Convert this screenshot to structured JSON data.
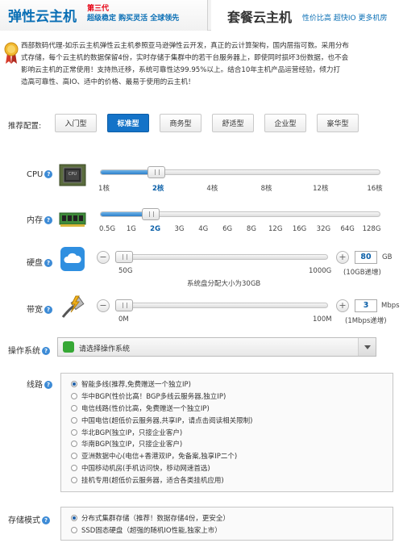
{
  "tabs": {
    "active": {
      "title": "弹性云主机",
      "badge": "第三代",
      "subtitle": "超级稳定 购买灵活 全球领先"
    },
    "inactive": {
      "title": "套餐云主机",
      "subtitle": "性价比高 超快IO 更多机房"
    }
  },
  "intro": {
    "lines": [
      "西部数码代理-如乐云主机弹性云主机参照亚马逊弹性云开发，真正的云计算架构，国内层指可数。采用分布",
      "式存储，每个云主机的数据保留4份，实时存储于集群中的若干台服务器上，即使同时损坏3份数据，也不会",
      "影响云主机的正常使用！支持热迁移，系统可靠性达99.95%以上。结合10年主机产品运营经验，倾力打",
      "造高可靠性、高IO、适中的价格、最易于使用的云主机！"
    ]
  },
  "preset": {
    "label": "推荐配置:",
    "options": [
      "入门型",
      "标准型",
      "商务型",
      "舒适型",
      "企业型",
      "豪华型"
    ],
    "selected_index": 1
  },
  "cpu": {
    "label": "CPU",
    "ticks": [
      "1核",
      "2核",
      "4核",
      "8核",
      "12核",
      "16核"
    ],
    "selected": "2核",
    "level": 0.2
  },
  "memory": {
    "label": "内存",
    "ticks": [
      "0.5G",
      "1G",
      "2G",
      "3G",
      "4G",
      "6G",
      "8G",
      "12G",
      "16G",
      "32G",
      "64G",
      "128G"
    ],
    "selected": "2G",
    "level": 0.18
  },
  "disk": {
    "label": "硬盘",
    "minus": "−",
    "plus": "+",
    "value": "80",
    "unit": "GB",
    "min_label": "50G",
    "max_label": "1000G",
    "step_note": "(10GB递增)",
    "note": "系统盘分配大小为30GB",
    "level": 0.03
  },
  "bandwidth": {
    "label": "带宽",
    "minus": "−",
    "plus": "+",
    "value": "3",
    "unit": "Mbps",
    "min_label": "0M",
    "max_label": "100M",
    "step_note": "(1Mbps递增)",
    "level": 0.03
  },
  "os": {
    "label": "操作系统",
    "placeholder": "请选择操作系统"
  },
  "line": {
    "label": "线路",
    "options": [
      "智能多线(推荐,免费赠送一个独立IP)",
      "华中BGP(性价比高！BGP多线云服务器,独立IP)",
      "电信线路(性价比高，免费赠送一个独立IP)",
      "中国电信(超低价云服务器,共享IP，请点击阅读相关限制)",
      "华北BGP(独立IP，只接企业客户)",
      "华南BGP(独立IP，只接企业客户)",
      "亚洲数据中心(电信+香港双IP，免备案,独享IP二个)",
      "中国移动机房(手机访问快，移动网速首选)",
      "挂机专用(超低价云服务器，适合各类挂机应用)"
    ],
    "selected_index": 0
  },
  "storage": {
    "label": "存储模式",
    "options": [
      "分布式集群存储（推荐！数据存储4份，更安全）",
      "SSD固态硬盘（超强的随机IO性能,独家上市）"
    ],
    "selected_index": 0
  },
  "help_glyph": "?",
  "colors": {
    "accent": "#1473c8",
    "badge": "#e60012",
    "os_icon": "#36a835"
  }
}
